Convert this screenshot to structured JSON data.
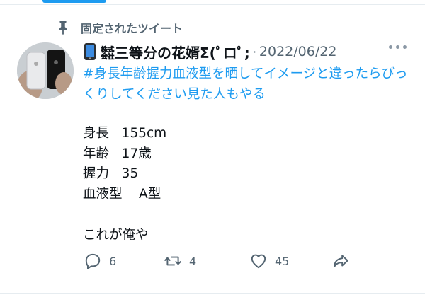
{
  "pinned": {
    "label": "固定されたツイート",
    "icon": "pin-icon"
  },
  "tweet": {
    "author": {
      "display_name": "㍿三等分の花婿Σ(ﾟロﾟ;",
      "emoji_icon": "mobile-phone-icon"
    },
    "separator": "·",
    "date": "2022/06/22",
    "hashtag_text": "#身長年齢握力血液型を晒してイメージと違ったらびっくりしてください見た人もやる",
    "profile": [
      {
        "key": "身長",
        "value": "155cm"
      },
      {
        "key": "年齢",
        "value": "17歳"
      },
      {
        "key": "握力",
        "value": "35"
      },
      {
        "key": "血液型",
        "value": "A型"
      }
    ],
    "closing": "これが俺や"
  },
  "actions": {
    "reply_count": "6",
    "retweet_count": "4",
    "like_count": "45"
  },
  "colors": {
    "accent": "#1d9bf0",
    "muted": "#536471",
    "text": "#0f1419"
  }
}
